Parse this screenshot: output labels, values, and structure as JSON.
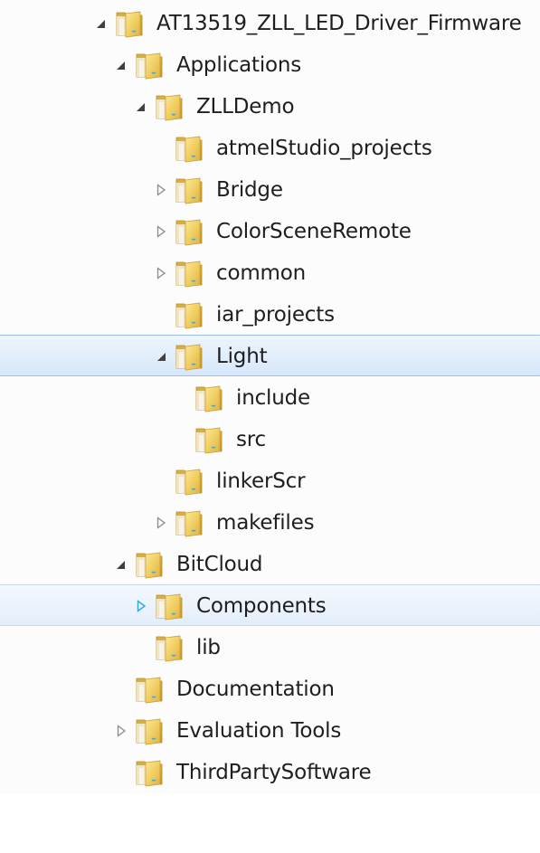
{
  "tree": {
    "root": {
      "label": "AT13519_ZLL_LED_Driver_Firmware",
      "icon": "folder-icon",
      "state": "expanded"
    },
    "applications": {
      "label": "Applications",
      "icon": "folder-icon",
      "state": "expanded"
    },
    "zll_demo": {
      "label": "ZLLDemo",
      "icon": "folder-icon",
      "state": "expanded"
    },
    "atmel_studio_projects": {
      "label": "atmelStudio_projects",
      "icon": "folder-icon",
      "state": "leaf"
    },
    "bridge": {
      "label": "Bridge",
      "icon": "folder-icon",
      "state": "collapsed"
    },
    "color_scene_remote": {
      "label": "ColorSceneRemote",
      "icon": "folder-icon",
      "state": "collapsed"
    },
    "common": {
      "label": "common",
      "icon": "folder-icon",
      "state": "collapsed"
    },
    "iar_projects": {
      "label": "iar_projects",
      "icon": "folder-icon",
      "state": "leaf"
    },
    "light": {
      "label": "Light",
      "icon": "folder-icon",
      "state": "expanded",
      "selected": true
    },
    "include": {
      "label": "include",
      "icon": "folder-icon",
      "state": "leaf"
    },
    "src": {
      "label": "src",
      "icon": "folder-icon",
      "state": "leaf"
    },
    "linker_scr": {
      "label": "linkerScr",
      "icon": "folder-icon",
      "state": "leaf"
    },
    "makefiles": {
      "label": "makefiles",
      "icon": "folder-icon",
      "state": "collapsed"
    },
    "bitcloud": {
      "label": "BitCloud",
      "icon": "folder-icon",
      "state": "expanded"
    },
    "components": {
      "label": "Components",
      "icon": "folder-icon",
      "state": "collapsed",
      "hover": true
    },
    "lib": {
      "label": "lib",
      "icon": "folder-icon",
      "state": "leaf"
    },
    "documentation": {
      "label": "Documentation",
      "icon": "folder-icon",
      "state": "leaf"
    },
    "evaluation_tools": {
      "label": "Evaluation Tools",
      "icon": "folder-icon",
      "state": "collapsed"
    },
    "third_party_software": {
      "label": "ThirdPartySoftware",
      "icon": "folder-icon",
      "state": "leaf"
    }
  },
  "colors": {
    "selection_border": "#9bc0ec",
    "selection_fill": "#d6e7fb",
    "hover_border": "#c3d8f3",
    "folder_yellow": "#f1cf62",
    "hot_arrow": "#2ea7e0"
  }
}
